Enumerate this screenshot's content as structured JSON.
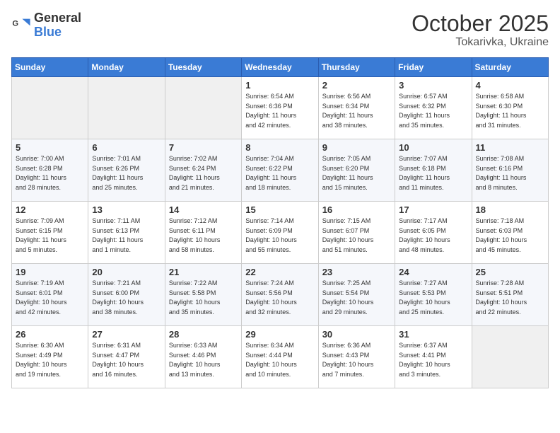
{
  "header": {
    "logo_general": "General",
    "logo_blue": "Blue",
    "title": "October 2025",
    "subtitle": "Tokarivka, Ukraine"
  },
  "days_of_week": [
    "Sunday",
    "Monday",
    "Tuesday",
    "Wednesday",
    "Thursday",
    "Friday",
    "Saturday"
  ],
  "weeks": [
    [
      {
        "day": "",
        "info": ""
      },
      {
        "day": "",
        "info": ""
      },
      {
        "day": "",
        "info": ""
      },
      {
        "day": "1",
        "info": "Sunrise: 6:54 AM\nSunset: 6:36 PM\nDaylight: 11 hours\nand 42 minutes."
      },
      {
        "day": "2",
        "info": "Sunrise: 6:56 AM\nSunset: 6:34 PM\nDaylight: 11 hours\nand 38 minutes."
      },
      {
        "day": "3",
        "info": "Sunrise: 6:57 AM\nSunset: 6:32 PM\nDaylight: 11 hours\nand 35 minutes."
      },
      {
        "day": "4",
        "info": "Sunrise: 6:58 AM\nSunset: 6:30 PM\nDaylight: 11 hours\nand 31 minutes."
      }
    ],
    [
      {
        "day": "5",
        "info": "Sunrise: 7:00 AM\nSunset: 6:28 PM\nDaylight: 11 hours\nand 28 minutes."
      },
      {
        "day": "6",
        "info": "Sunrise: 7:01 AM\nSunset: 6:26 PM\nDaylight: 11 hours\nand 25 minutes."
      },
      {
        "day": "7",
        "info": "Sunrise: 7:02 AM\nSunset: 6:24 PM\nDaylight: 11 hours\nand 21 minutes."
      },
      {
        "day": "8",
        "info": "Sunrise: 7:04 AM\nSunset: 6:22 PM\nDaylight: 11 hours\nand 18 minutes."
      },
      {
        "day": "9",
        "info": "Sunrise: 7:05 AM\nSunset: 6:20 PM\nDaylight: 11 hours\nand 15 minutes."
      },
      {
        "day": "10",
        "info": "Sunrise: 7:07 AM\nSunset: 6:18 PM\nDaylight: 11 hours\nand 11 minutes."
      },
      {
        "day": "11",
        "info": "Sunrise: 7:08 AM\nSunset: 6:16 PM\nDaylight: 11 hours\nand 8 minutes."
      }
    ],
    [
      {
        "day": "12",
        "info": "Sunrise: 7:09 AM\nSunset: 6:15 PM\nDaylight: 11 hours\nand 5 minutes."
      },
      {
        "day": "13",
        "info": "Sunrise: 7:11 AM\nSunset: 6:13 PM\nDaylight: 11 hours\nand 1 minute."
      },
      {
        "day": "14",
        "info": "Sunrise: 7:12 AM\nSunset: 6:11 PM\nDaylight: 10 hours\nand 58 minutes."
      },
      {
        "day": "15",
        "info": "Sunrise: 7:14 AM\nSunset: 6:09 PM\nDaylight: 10 hours\nand 55 minutes."
      },
      {
        "day": "16",
        "info": "Sunrise: 7:15 AM\nSunset: 6:07 PM\nDaylight: 10 hours\nand 51 minutes."
      },
      {
        "day": "17",
        "info": "Sunrise: 7:17 AM\nSunset: 6:05 PM\nDaylight: 10 hours\nand 48 minutes."
      },
      {
        "day": "18",
        "info": "Sunrise: 7:18 AM\nSunset: 6:03 PM\nDaylight: 10 hours\nand 45 minutes."
      }
    ],
    [
      {
        "day": "19",
        "info": "Sunrise: 7:19 AM\nSunset: 6:01 PM\nDaylight: 10 hours\nand 42 minutes."
      },
      {
        "day": "20",
        "info": "Sunrise: 7:21 AM\nSunset: 6:00 PM\nDaylight: 10 hours\nand 38 minutes."
      },
      {
        "day": "21",
        "info": "Sunrise: 7:22 AM\nSunset: 5:58 PM\nDaylight: 10 hours\nand 35 minutes."
      },
      {
        "day": "22",
        "info": "Sunrise: 7:24 AM\nSunset: 5:56 PM\nDaylight: 10 hours\nand 32 minutes."
      },
      {
        "day": "23",
        "info": "Sunrise: 7:25 AM\nSunset: 5:54 PM\nDaylight: 10 hours\nand 29 minutes."
      },
      {
        "day": "24",
        "info": "Sunrise: 7:27 AM\nSunset: 5:53 PM\nDaylight: 10 hours\nand 25 minutes."
      },
      {
        "day": "25",
        "info": "Sunrise: 7:28 AM\nSunset: 5:51 PM\nDaylight: 10 hours\nand 22 minutes."
      }
    ],
    [
      {
        "day": "26",
        "info": "Sunrise: 6:30 AM\nSunset: 4:49 PM\nDaylight: 10 hours\nand 19 minutes."
      },
      {
        "day": "27",
        "info": "Sunrise: 6:31 AM\nSunset: 4:47 PM\nDaylight: 10 hours\nand 16 minutes."
      },
      {
        "day": "28",
        "info": "Sunrise: 6:33 AM\nSunset: 4:46 PM\nDaylight: 10 hours\nand 13 minutes."
      },
      {
        "day": "29",
        "info": "Sunrise: 6:34 AM\nSunset: 4:44 PM\nDaylight: 10 hours\nand 10 minutes."
      },
      {
        "day": "30",
        "info": "Sunrise: 6:36 AM\nSunset: 4:43 PM\nDaylight: 10 hours\nand 7 minutes."
      },
      {
        "day": "31",
        "info": "Sunrise: 6:37 AM\nSunset: 4:41 PM\nDaylight: 10 hours\nand 3 minutes."
      },
      {
        "day": "",
        "info": ""
      }
    ]
  ]
}
